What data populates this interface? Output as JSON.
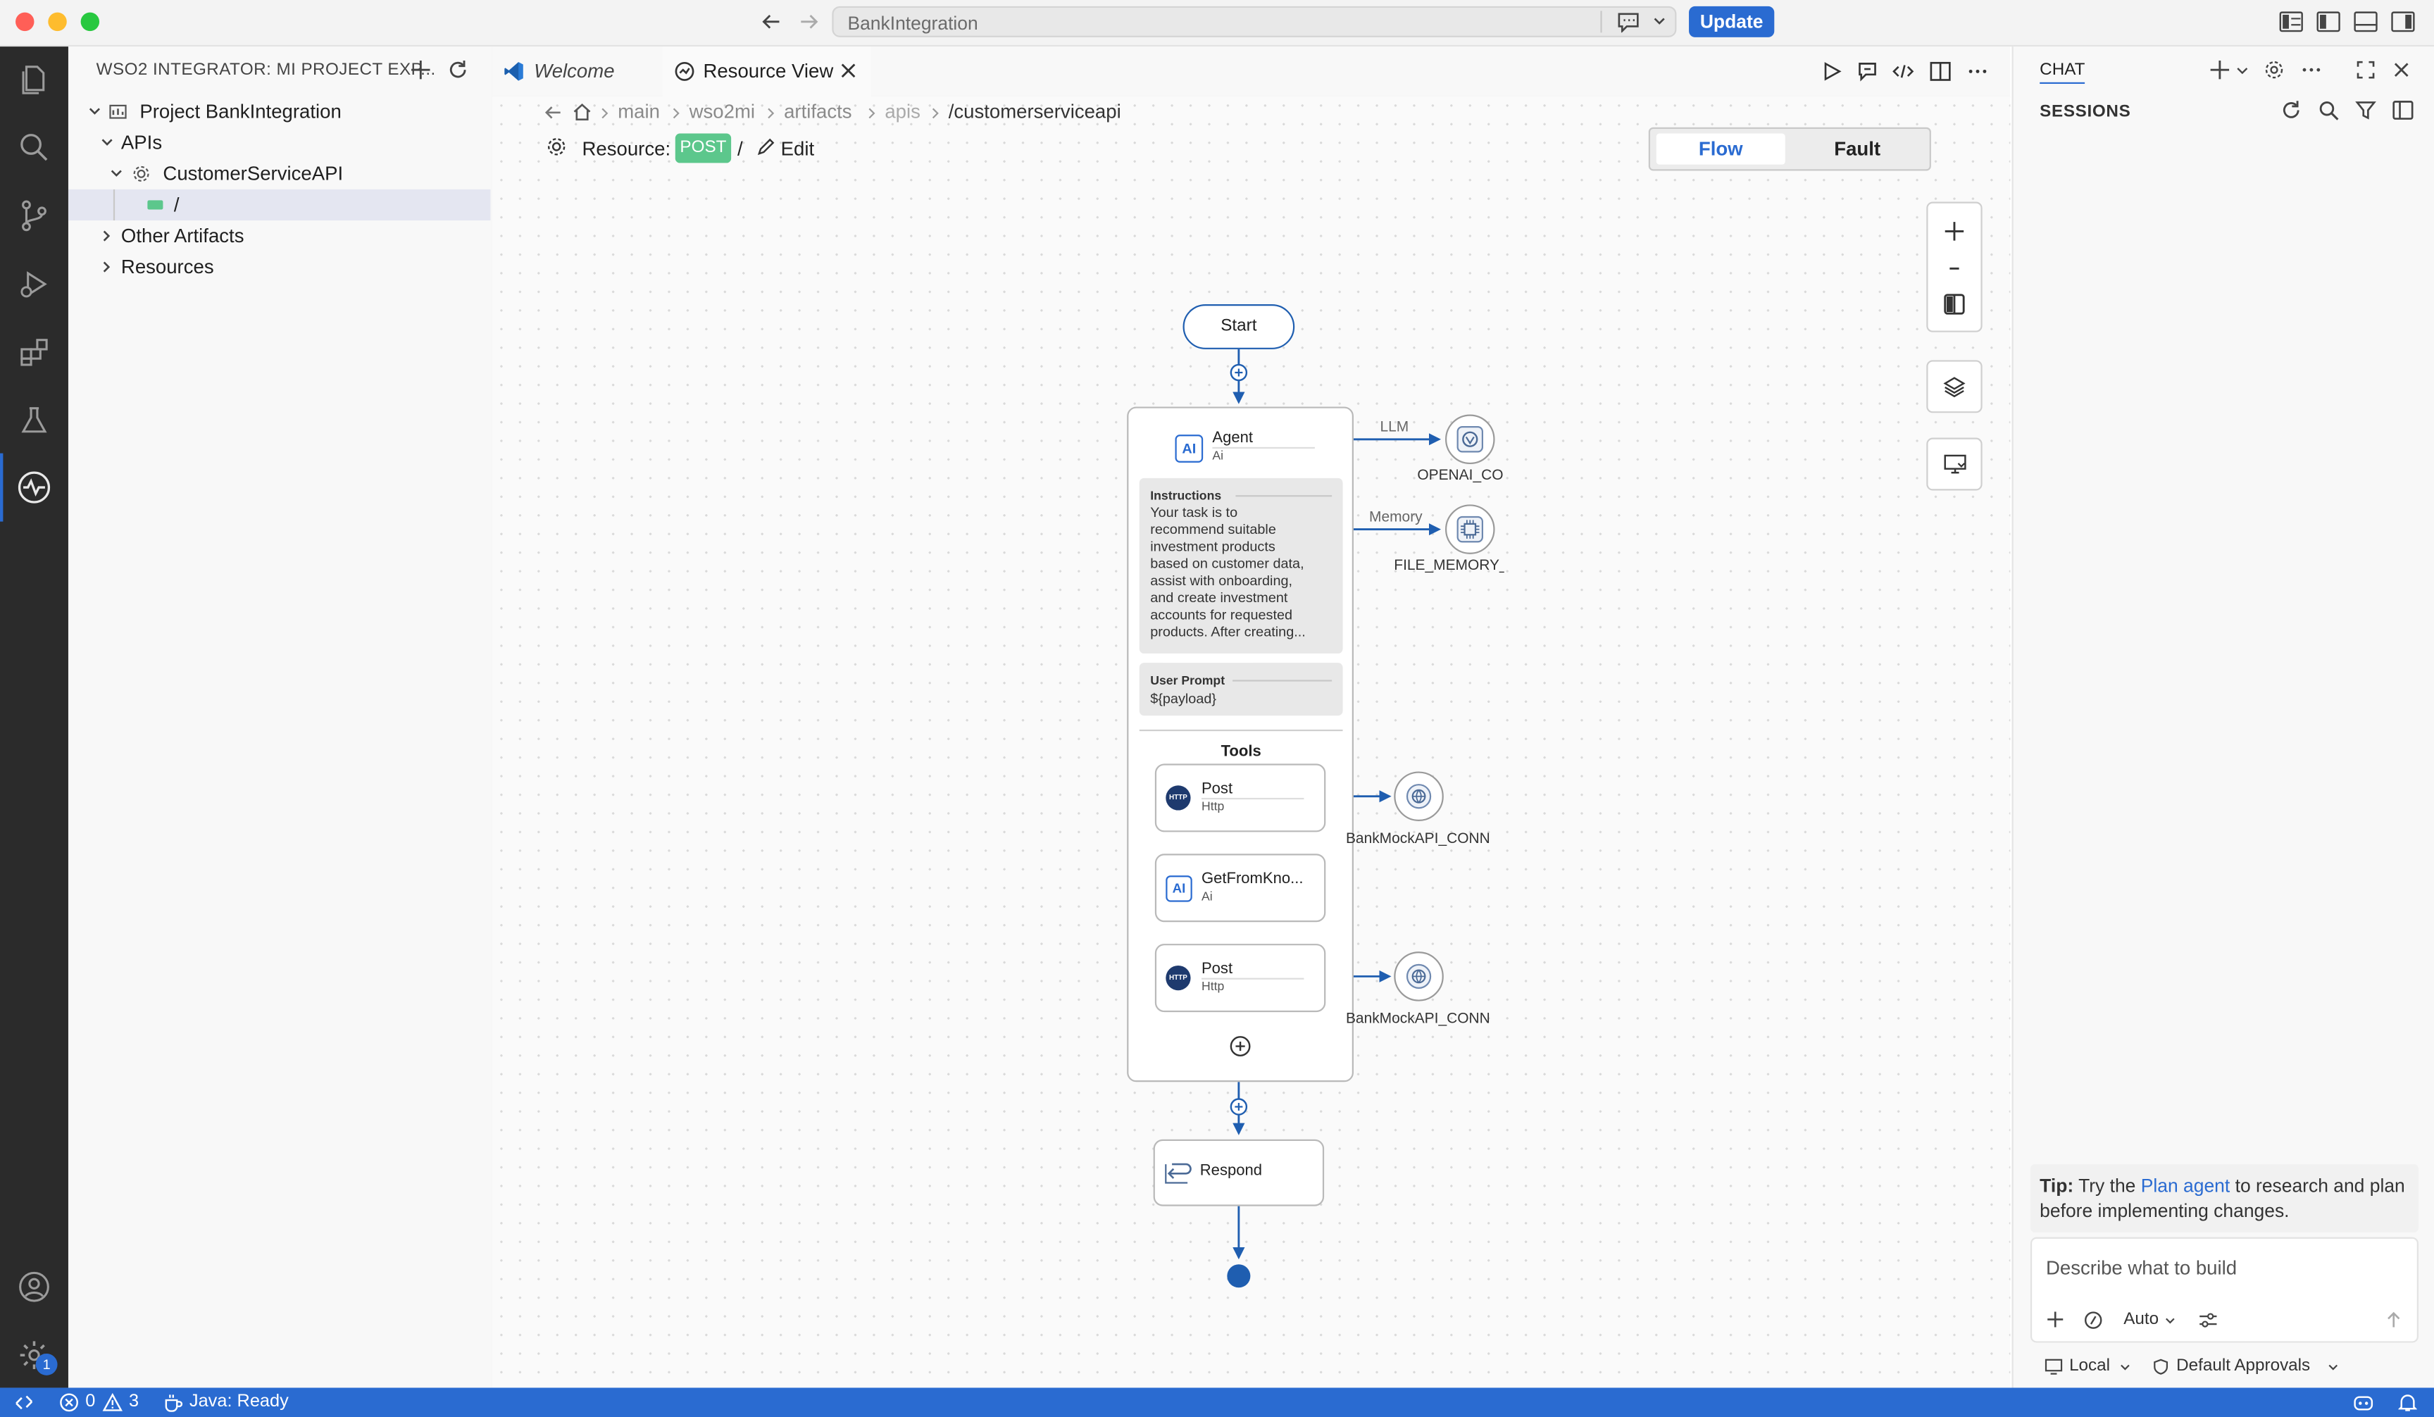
{
  "titlebar": {
    "search_text": "BankIntegration",
    "update_label": "Update",
    "traffic_colors": [
      "#ff5f57",
      "#febc2e",
      "#28c840"
    ]
  },
  "sidebar": {
    "title": "WSO2 INTEGRATOR: MI PROJECT EXP...",
    "tree": {
      "project": "Project BankIntegration",
      "apis": "APIs",
      "api": "CustomerServiceAPI",
      "resource": "/",
      "other": "Other Artifacts",
      "resources": "Resources"
    }
  },
  "tabs": {
    "welcome": "Welcome",
    "resource_view": "Resource View"
  },
  "breadcrumb": [
    "main",
    "wso2mi",
    "artifacts",
    "apis",
    "/customerserviceapi"
  ],
  "resource": {
    "label": "Resource:",
    "method": "POST",
    "path": "/",
    "edit": "Edit"
  },
  "toggle": {
    "flow": "Flow",
    "fault": "Fault"
  },
  "diagram": {
    "start": "Start",
    "agent_title": "Agent",
    "agent_sub": "Ai",
    "instructions_title": "Instructions",
    "instructions_lines": [
      "Your task is to",
      "recommend suitable",
      "investment products",
      "based on customer data,",
      "assist with onboarding,",
      "and create investment",
      "accounts for requested",
      "products. After creating..."
    ],
    "user_prompt_title": "User Prompt",
    "user_prompt_value": "${payload}",
    "tools_title": "Tools",
    "tool1_title": "Post",
    "tool1_sub": "Http",
    "tool2_title": "GetFromKno...",
    "tool2_sub": "Ai",
    "tool3_title": "Post",
    "tool3_sub": "Http",
    "llm_label": "LLM",
    "memory_label": "Memory",
    "openai_label": "OPENAI_CO",
    "filememory_label": "FILE_MEMORY_",
    "bank1_label": "BankMockAPI_CONN",
    "bank2_label": "BankMockAPI_CONN",
    "respond": "Respond"
  },
  "chat": {
    "tab": "CHAT",
    "sessions": "SESSIONS",
    "tip_label": "Tip:",
    "tip_pre": " Try the ",
    "tip_link": "Plan agent",
    "tip_post": " to research and plan before implementing changes.",
    "placeholder": "Describe what to build",
    "mode": "Auto",
    "local": "Local",
    "approvals": "Default Approvals"
  },
  "status": {
    "errors": "0",
    "warnings": "3",
    "java": "Java: Ready",
    "notifications_badge": "1"
  },
  "colors": {
    "accent": "#2a6bd1",
    "post_badge": "#5cc78c",
    "activity_bg": "#2b2b2b"
  }
}
